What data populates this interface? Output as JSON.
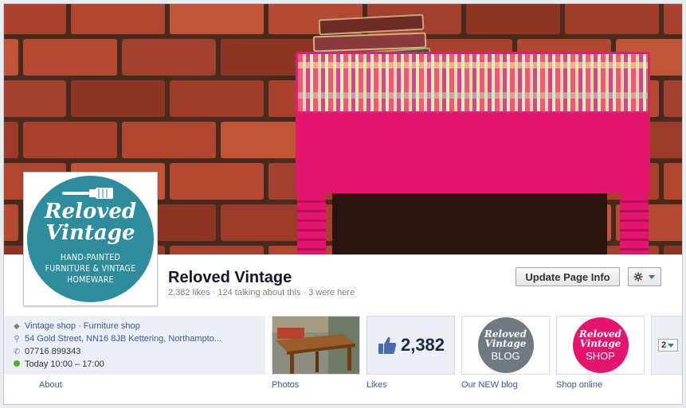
{
  "page": {
    "name": "Reloved Vintage",
    "stats": "2,382 likes · 124 talking about this · 3 were here"
  },
  "profile": {
    "logo_title_1": "Reloved",
    "logo_title_2": "Vintage",
    "logo_sub_1": "HAND-PAINTED",
    "logo_sub_2": "FURNITURE & VINTAGE",
    "logo_sub_3": "HOMEWARE"
  },
  "buttons": {
    "update_info": "Update Page Info",
    "gear_icon": "gear-icon"
  },
  "about": {
    "category": "Vintage shop · Furniture shop",
    "address": "54 Gold Street, NN16 8JB Kettering, Northampto...",
    "phone": "07716 899343",
    "hours": "Today 10:00 – 17:00",
    "label": "About"
  },
  "apps": {
    "photos_label": "Photos",
    "likes_count": "2,382",
    "likes_label": "Likes",
    "blog_label": "Our NEW blog",
    "blog_logo_1": "Reloved",
    "blog_logo_2": "Vintage",
    "blog_logo_3": "BLOG",
    "shop_label": "Shop online",
    "shop_logo_1": "Reloved",
    "shop_logo_2": "Vintage",
    "shop_logo_3": "SHOP",
    "more_count": "2"
  },
  "colors": {
    "facebook_link": "#3b5998",
    "logo_teal": "#2e8c9c",
    "blog_grey": "#6f7a80",
    "shop_pink": "#e3156f"
  }
}
